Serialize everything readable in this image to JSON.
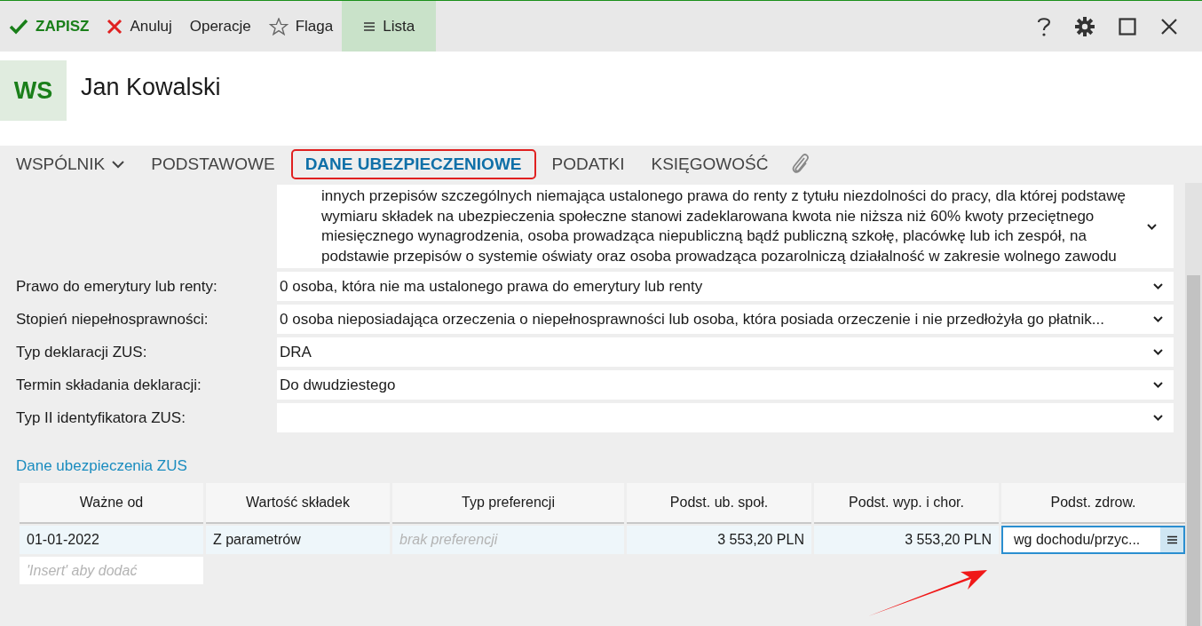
{
  "toolbar": {
    "items": [
      {
        "label": "ZAPISZ",
        "kind": "save",
        "selected": false
      },
      {
        "label": "Anuluj",
        "kind": "cancel",
        "selected": false
      },
      {
        "label": "Operacje",
        "kind": "plain",
        "selected": false
      },
      {
        "label": "Flaga",
        "kind": "flag",
        "selected": false
      },
      {
        "label": "Lista",
        "kind": "list",
        "selected": true
      }
    ]
  },
  "header": {
    "avatar": "WS",
    "name": "Jan Kowalski"
  },
  "tabs": [
    {
      "label": "WSPÓLNIK",
      "menu": true,
      "selected": false
    },
    {
      "label": "PODSTAWOWE",
      "menu": false,
      "selected": false
    },
    {
      "label": "DANE UBEZPIECZENIOWE",
      "menu": false,
      "selected": true
    },
    {
      "label": "PODATKI",
      "menu": false,
      "selected": false
    },
    {
      "label": "KSIĘGOWOŚĆ",
      "menu": false,
      "selected": false
    }
  ],
  "form": {
    "fields": [
      {
        "value": "innych przepisów szczególnych niemająca ustalonego prawa do renty z tytułu niezdolności do pracy, dla której podstawę wymiaru składek na ubezpieczenia społeczne stanowi zadeklarowana kwota nie niższa niż 60% kwoty przeciętnego miesięcznego wynagrodzenia, osoba prowadząca niepubliczną bądź publiczną szkołę, placówkę lub ich zespół, na podstawie przepisów o systemie oświaty oraz osoba prowadząca pozarolniczą działalność w zakresie wolnego zawodu"
      },
      {
        "label": "Prawo do emerytury lub renty:",
        "value": "0  osoba, która nie ma ustalonego prawa do emerytury lub renty"
      },
      {
        "label": "Stopień niepełnosprawności:",
        "value": "0  osoba nieposiadająca orzeczenia o niepełnosprawności lub osoba, która posiada orzeczenie i nie przedłożyła go płatnik..."
      },
      {
        "label": "Typ deklaracji ZUS:",
        "value": "DRA"
      },
      {
        "label": "Termin składania deklaracji:",
        "value": "Do dwudziestego"
      },
      {
        "label": "Typ II identyfikatora ZUS:"
      }
    ]
  },
  "section": {
    "title": "Dane ubezpieczenia ZUS",
    "table": {
      "columns": [
        "Ważne od",
        "Wartość składek",
        "Typ preferencji",
        "Podst. ub. społ.",
        "Podst. wyp. i chor.",
        "Podst. zdrow."
      ],
      "rows": [
        [
          {
            "text": "01-01-2022",
            "kind": "text"
          },
          {
            "text": "Z parametrów",
            "kind": "text"
          },
          {
            "text": "brak preferencji",
            "kind": "placeholder"
          },
          {
            "text": "3 553,20 PLN",
            "kind": "number"
          },
          {
            "text": "3 553,20 PLN",
            "kind": "number"
          },
          {
            "text": "wg dochodu/przyc...",
            "kind": "editing"
          }
        ]
      ],
      "new_row_placeholder": "'Insert' aby dodać"
    }
  }
}
